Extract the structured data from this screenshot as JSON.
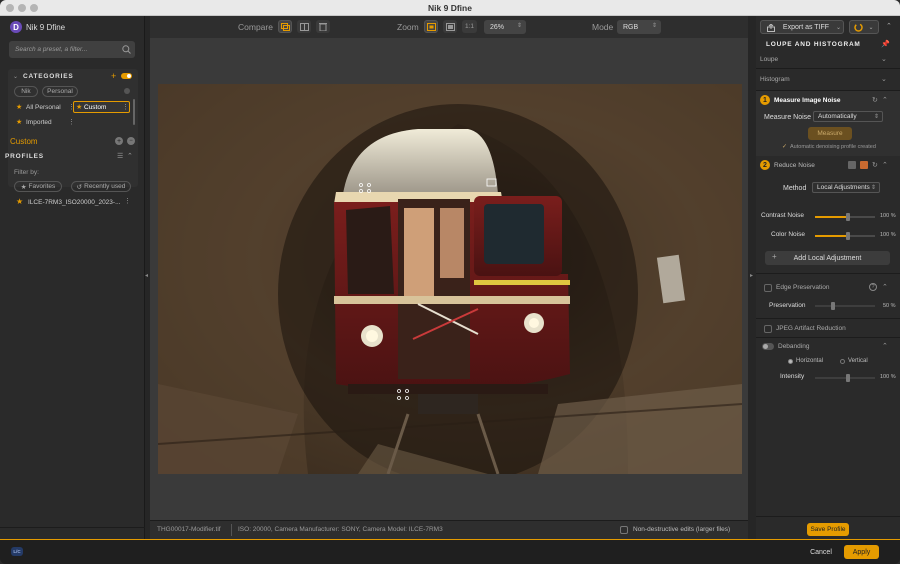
{
  "window": {
    "title": "Nik 9 Dfine"
  },
  "left": {
    "app_name": "Nik 9 Dfine",
    "logo_letter": "D",
    "search_placeholder": "Search a preset, a filter...",
    "categories_label": "CATEGORIES",
    "chips": [
      "Nik",
      "Personal"
    ],
    "items": [
      {
        "label": "All Personal",
        "starred": true
      },
      {
        "label": "Custom",
        "starred": true,
        "selected": true
      },
      {
        "label": "Imported",
        "starred": true
      }
    ],
    "custom_label": "Custom",
    "profiles_label": "PROFILES",
    "filter_by": "Filter by:",
    "filters": [
      "Favorites",
      "Recently used"
    ],
    "profile_item": "ILCE-7RM3_ISO20000_2023-..."
  },
  "toolbar": {
    "compare_label": "Compare",
    "zoom_label": "Zoom",
    "zoom_ratio": "1:1",
    "zoom_value": "26%",
    "mode_label": "Mode",
    "mode_value": "RGB"
  },
  "status": {
    "filename": "THG00017-Modifier.tif",
    "info": "ISO: 20000, Camera Manufacturer: SONY, Camera Model: ILCE-7RM3",
    "nondestructive": "Non-destructive edits (larger files)"
  },
  "right": {
    "export_label": "Export as TIFF",
    "loupe_header": "LOUPE AND HISTOGRAM",
    "loupe": "Loupe",
    "histogram": "Histogram",
    "step1_num": "1",
    "step1_title": "Measure Image Noise",
    "measure_noise_label": "Measure Noise",
    "measure_noise_value": "Automatically",
    "measure_button": "Measure",
    "profile_created": "Automatic denoising profile created",
    "step2_num": "2",
    "step2_title": "Reduce Noise",
    "method_label": "Method",
    "method_value": "Local Adjustments",
    "contrast_noise": {
      "label": "Contrast Noise",
      "value": "100 %",
      "level": 1.0
    },
    "color_noise": {
      "label": "Color Noise",
      "value": "100 %",
      "level": 1.0
    },
    "add_local": "Add Local Adjustment",
    "edge_preservation": "Edge Preservation",
    "preservation": {
      "label": "Preservation",
      "value": "50 %",
      "level": 0.5
    },
    "jpeg_artifact": "JPEG Artifact Reduction",
    "debanding": "Debanding",
    "horizontal": "Horizontal",
    "vertical": "Vertical",
    "intensity": {
      "label": "Intensity",
      "value": "100 %",
      "level": 1.0
    },
    "save_profile": "Save Profile"
  },
  "footer": {
    "cancel": "Cancel",
    "apply": "Apply",
    "badge": "L/C"
  },
  "colors": {
    "accent": "#e59b00",
    "panel": "#2a2a2a",
    "canvas": "#3a3a3a"
  }
}
